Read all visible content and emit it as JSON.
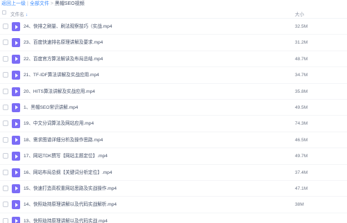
{
  "breadcrumb": {
    "back": "返回上一级",
    "all_files": "全部文件",
    "separator": ">",
    "current": "黑帽SEO视频"
  },
  "header": {
    "name_label": "文件名",
    "sort_arrow": "↓",
    "size_label": "大小"
  },
  "colors": {
    "accent": "#3b8cff",
    "video_icon": "#7b6cf6"
  },
  "files": [
    {
      "name": "24、快排之刷量、刷法观察技巧（实战.mp4",
      "size": "32.5M",
      "icon": "video-file-icon"
    },
    {
      "name": "23、百度快速排名原理讲解及要求.mp4",
      "size": "31.2M",
      "icon": "video-file-icon"
    },
    {
      "name": "22、百度官方算法解读及布局总结.mp4",
      "size": "48.7M",
      "icon": "video-file-icon"
    },
    {
      "name": "21、TF-IDF算法讲解及实战应用.mp4",
      "size": "34.7M",
      "icon": "video-file-icon"
    },
    {
      "name": "20、HITS算法讲解及实战应用.mp4",
      "size": "35.8M",
      "icon": "video-file-icon"
    },
    {
      "name": "1、黑帽SEO常识讲解.mp4",
      "size": "49.5M",
      "icon": "video-file-icon"
    },
    {
      "name": "19、中文分词算法及网站应用.mp4",
      "size": "74.3M",
      "icon": "video-file-icon"
    },
    {
      "name": "18、需求图谱详细分析及操作思路.mp4",
      "size": "46.5M",
      "icon": "video-file-icon"
    },
    {
      "name": "17、网站TDK撰写【网站主题定位】.mp4",
      "size": "49.7M",
      "icon": "video-file-icon"
    },
    {
      "name": "16、网站布局总纲【关键词分析定位】.mp4",
      "size": "37.4M",
      "icon": "video-file-icon"
    },
    {
      "name": "15、快速打造高权重网站思路及实战操作.mp4",
      "size": "47.1M",
      "icon": "video-file-icon"
    },
    {
      "name": "14、快照劫持原理讲解以及代码实战解析.mp4",
      "size": "38M",
      "icon": "video-file-icon"
    },
    {
      "name": "13、快照劫持原理讲解以及代码实战.mp4",
      "size": "",
      "icon": "video-file-icon"
    }
  ]
}
